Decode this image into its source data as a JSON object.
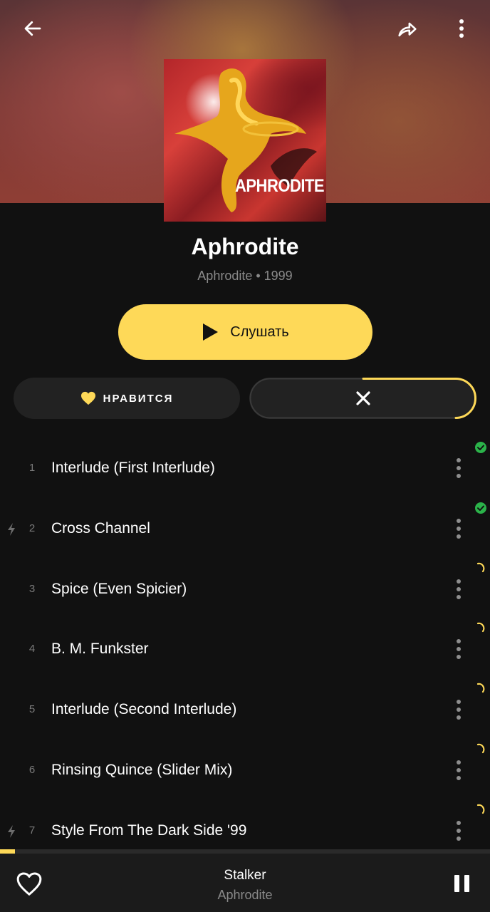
{
  "header": {
    "back_icon": "arrow-left-icon",
    "share_icon": "share-icon",
    "more_icon": "more-vertical-icon"
  },
  "album": {
    "cover_text": "APHRODITE",
    "title": "Aphrodite",
    "subtitle": "Aphrodite • 1999"
  },
  "actions": {
    "play_label": "Слушать",
    "like_label": "НРАВИТСЯ",
    "download_progress": 0.55,
    "accent_color": "#fed958"
  },
  "tracks": [
    {
      "number": "1",
      "title": "Interlude (First Interlude)",
      "bolt": false,
      "status": "downloaded"
    },
    {
      "number": "2",
      "title": "Cross Channel",
      "bolt": true,
      "status": "downloaded"
    },
    {
      "number": "3",
      "title": "Spice (Even Spicier)",
      "bolt": false,
      "status": "downloading"
    },
    {
      "number": "4",
      "title": "B. M. Funkster",
      "bolt": false,
      "status": "downloading"
    },
    {
      "number": "5",
      "title": "Interlude (Second Interlude)",
      "bolt": false,
      "status": "downloading"
    },
    {
      "number": "6",
      "title": "Rinsing Quince (Slider Mix)",
      "bolt": false,
      "status": "downloading"
    },
    {
      "number": "7",
      "title": "Style From The Dark Side '99",
      "bolt": true,
      "status": "downloading"
    }
  ],
  "player": {
    "title": "Stalker",
    "artist": "Aphrodite",
    "progress": 0.03
  },
  "colors": {
    "background": "#111111",
    "downloaded": "#2bb34a"
  }
}
